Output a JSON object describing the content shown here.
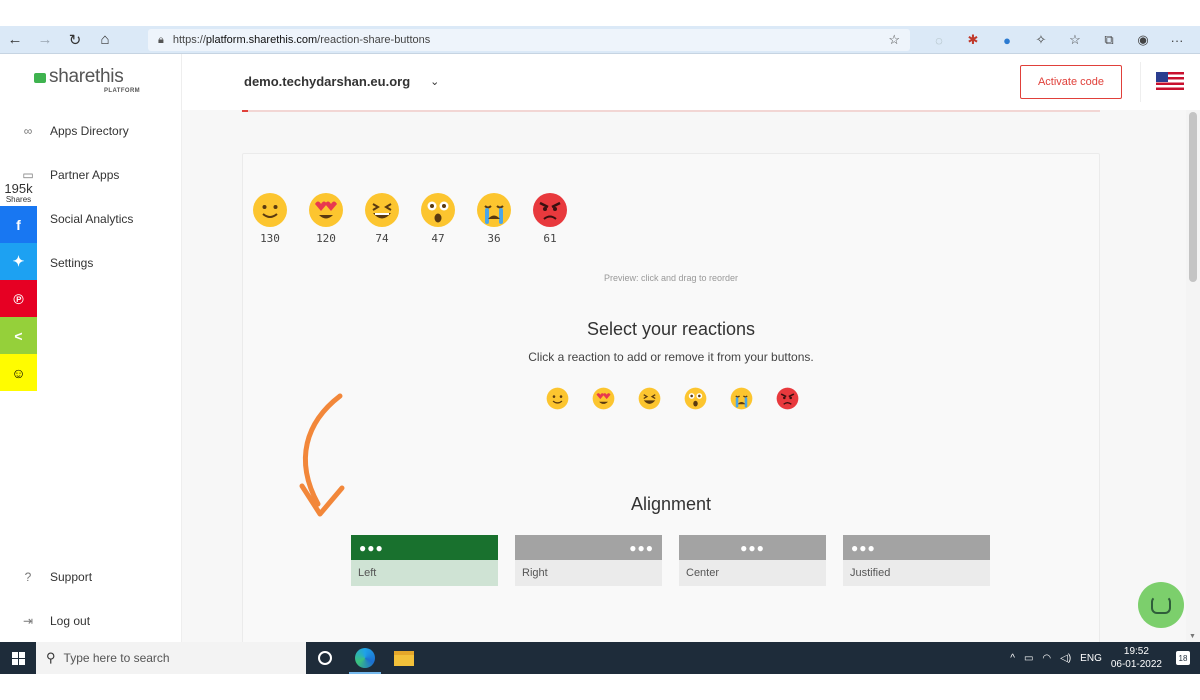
{
  "browser": {
    "url_prefix": "https://",
    "url_host": "platform.sharethis.com",
    "url_path": "/reaction-share-buttons"
  },
  "header": {
    "logo_text": "sharethis",
    "logo_sub": "PLATFORM",
    "site": "demo.techydarshan.eu.org",
    "activate_label": "Activate code"
  },
  "sidebar": {
    "items": [
      {
        "label": "Apps Directory",
        "icon": "apps-icon"
      },
      {
        "label": "Partner Apps",
        "icon": "partner-icon"
      },
      {
        "label": "Social Analytics",
        "icon": "analytics-icon"
      },
      {
        "label": "Settings",
        "icon": "settings-icon"
      }
    ],
    "support_label": "Support",
    "logout_label": "Log out"
  },
  "share_strip": {
    "count": "195k",
    "label": "Shares",
    "buttons": [
      {
        "name": "facebook",
        "color": "#1877f2",
        "glyph": "f"
      },
      {
        "name": "twitter",
        "color": "#1da1f2",
        "glyph": "t"
      },
      {
        "name": "pinterest",
        "color": "#e60023",
        "glyph": "p"
      },
      {
        "name": "sharethis",
        "color": "#95d03a",
        "glyph": "<"
      },
      {
        "name": "snapchat",
        "color": "#fffc00",
        "glyph": "s"
      }
    ]
  },
  "preview": {
    "reactions": [
      {
        "name": "smile",
        "count": "130"
      },
      {
        "name": "heart-eyes",
        "count": "120"
      },
      {
        "name": "laughing",
        "count": "74"
      },
      {
        "name": "surprised",
        "count": "47"
      },
      {
        "name": "crying",
        "count": "36"
      },
      {
        "name": "angry",
        "count": "61"
      }
    ],
    "hint": "Preview: click and drag to reorder"
  },
  "select": {
    "title": "Select your reactions",
    "subtitle": "Click a reaction to add or remove it from your buttons."
  },
  "alignment": {
    "title": "Alignment",
    "options": [
      {
        "label": "Left",
        "selected": true
      },
      {
        "label": "Right",
        "selected": false
      },
      {
        "label": "Center",
        "selected": false
      },
      {
        "label": "Justified",
        "selected": false
      }
    ],
    "dots": "●●●"
  },
  "taskbar": {
    "search_placeholder": "Type here to search",
    "lang": "ENG",
    "time": "19:52",
    "date": "06-01-2022",
    "notif_count": "18"
  },
  "colors": {
    "accent_red": "#e0403a",
    "selected_green": "#19712e",
    "brand_green": "#3fb34f"
  }
}
